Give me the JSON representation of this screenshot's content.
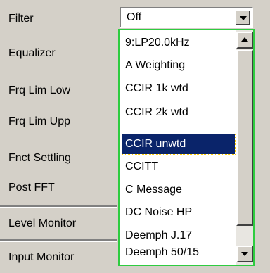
{
  "labels": {
    "filter": "Filter",
    "equalizer": "Equalizer",
    "frq_lim_low": "Frq Lim Low",
    "frq_lim_upp": "Frq Lim Upp",
    "fnct_settling": "Fnct Settling",
    "post_fft": "Post FFT",
    "level_monitor": "Level Monitor",
    "input_monitor": "Input Monitor"
  },
  "filter_combo": {
    "value": "Off"
  },
  "dropdown": {
    "options": [
      "9:LP20.0kHz",
      "A Weighting",
      "CCIR 1k wtd",
      "CCIR 2k wtd",
      "CCIR unwtd",
      "CCITT",
      "C Message",
      "DC Noise HP",
      "Deemph J.17",
      "Deemph 50/15"
    ],
    "selected": "CCIR unwtd",
    "icons": {
      "scroll_up": "arrow-up-icon",
      "scroll_down": "arrow-down-icon",
      "combo": "arrow-down-icon"
    },
    "colors": {
      "selected_bg": "#0a246a",
      "list_border": "#2ecc40"
    }
  }
}
